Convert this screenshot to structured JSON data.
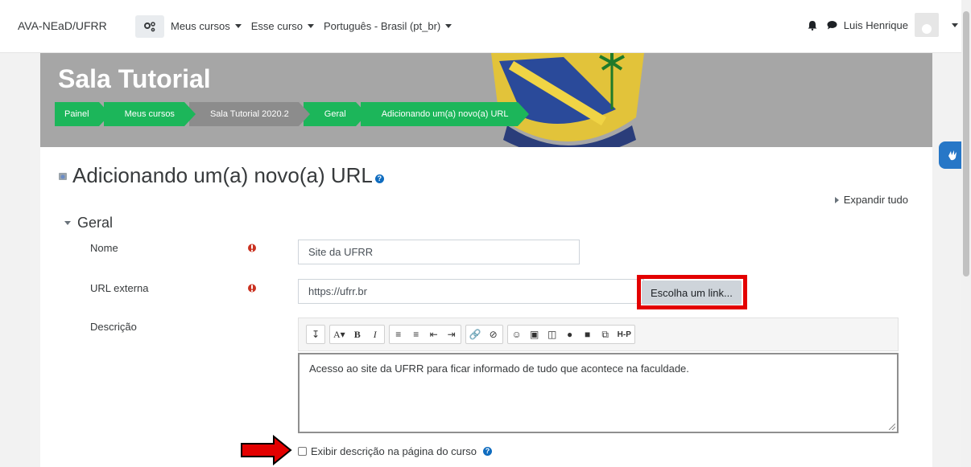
{
  "navbar": {
    "brand": "AVA-NEaD/UFRR",
    "menu": [
      {
        "label": "Meus cursos"
      },
      {
        "label": "Esse curso"
      },
      {
        "label": "Português - Brasil (pt_br)"
      }
    ],
    "user_name": "Luis Henrique"
  },
  "banner": {
    "title": "Sala Tutorial",
    "breadcrumb": [
      {
        "label": "Painel"
      },
      {
        "label": "Meus cursos"
      },
      {
        "label": "Sala Tutorial 2020.2"
      },
      {
        "label": "Geral"
      },
      {
        "label": "Adicionando um(a) novo(a) URL"
      }
    ],
    "accent_color": "#1cb65a"
  },
  "page": {
    "heading": "Adicionando um(a) novo(a) URL",
    "expand_all": "Expandir tudo",
    "section_title": "Geral"
  },
  "form": {
    "name_label": "Nome",
    "name_value": "Site da UFRR",
    "url_label": "URL externa",
    "url_value": "https://ufrr.br",
    "choose_link": "Escolha um link...",
    "description_label": "Descrição",
    "description_text": "Acesso ao site da UFRR para ficar informado de tudo que acontece na faculdade.",
    "show_description": "Exibir descrição na página do curso"
  },
  "icons": {
    "gear": "gear-icon",
    "bell": "bell-icon",
    "chat": "chat-icon",
    "required": "exclamation-icon",
    "sign_language": "sign-language-icon"
  },
  "colors": {
    "highlight_red": "#e30000",
    "link_blue": "#0f6cbf"
  }
}
